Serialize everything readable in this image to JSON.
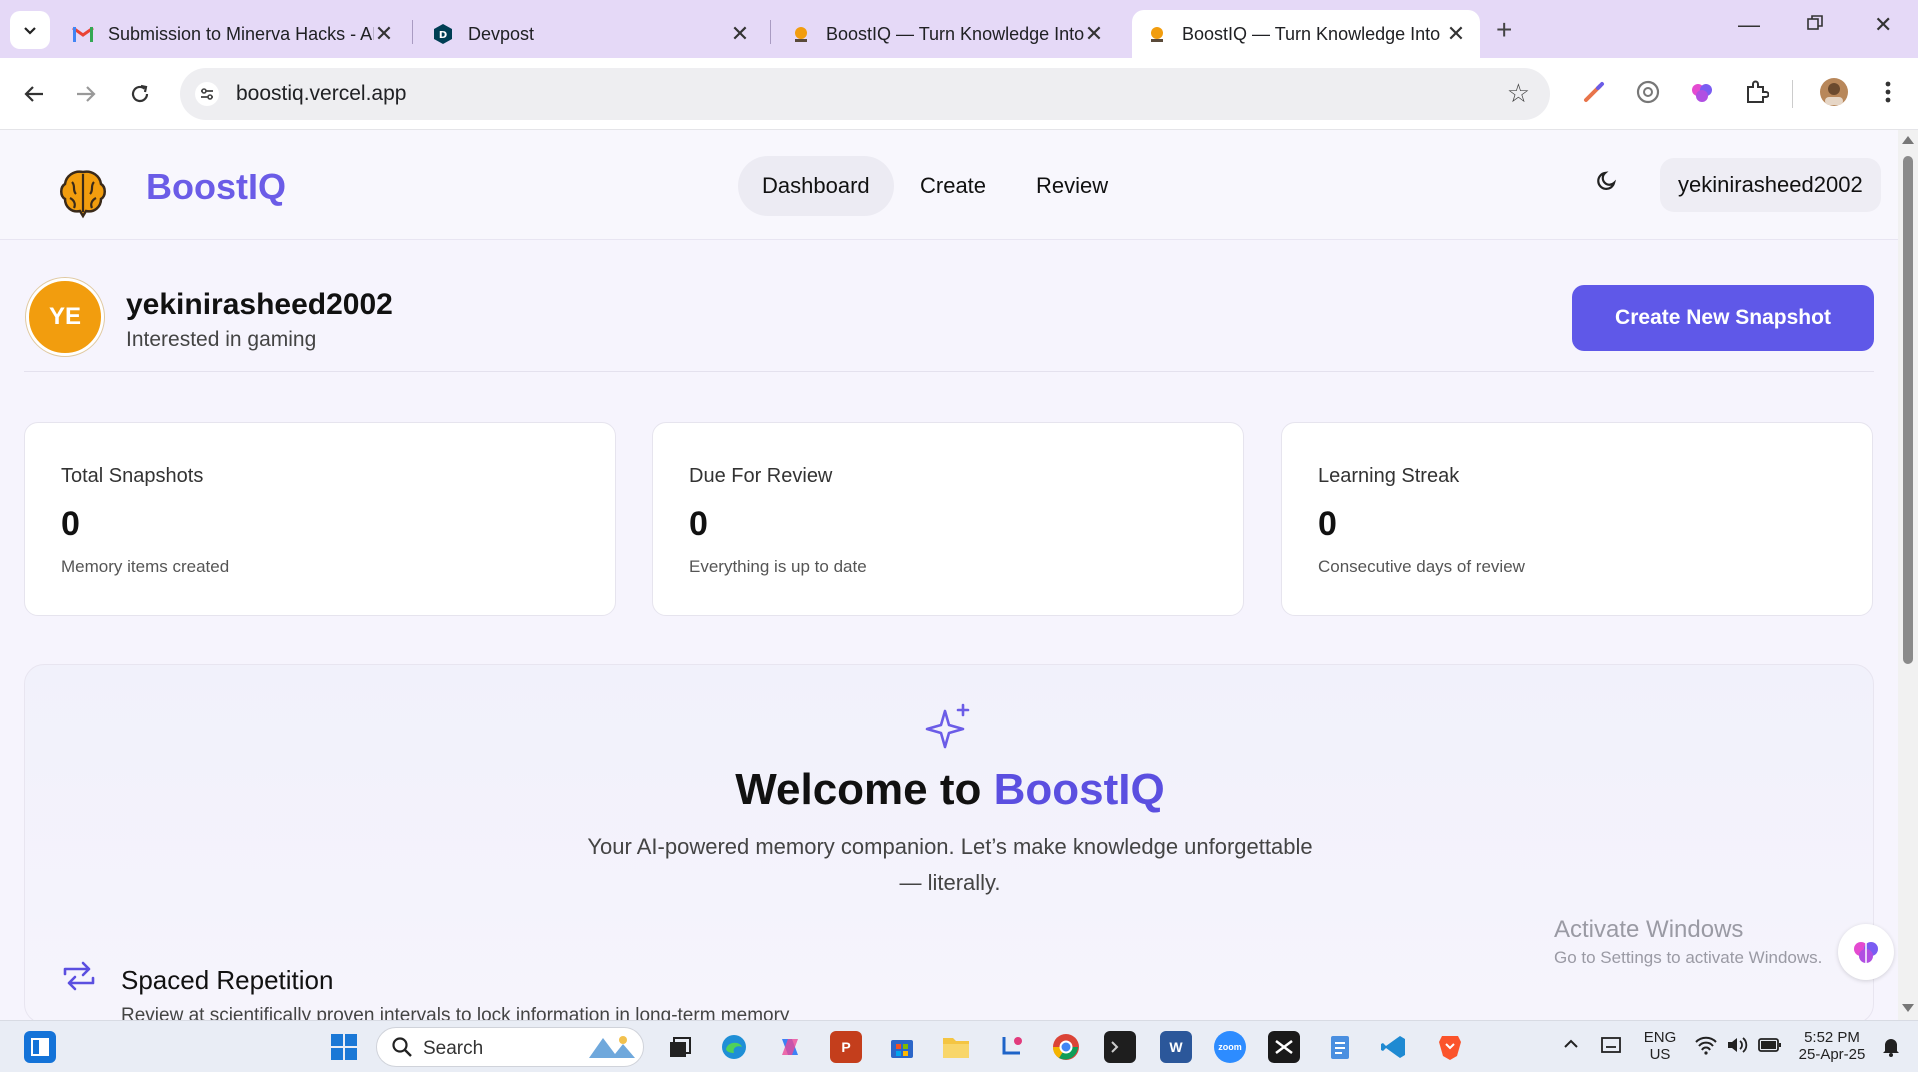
{
  "browser": {
    "tabs": [
      {
        "title": "Submission to Minerva Hacks - AI",
        "favicon": "gmail-icon",
        "active": false
      },
      {
        "title": "Devpost",
        "favicon": "devpost-icon",
        "active": false
      },
      {
        "title": "BoostIQ — Turn Knowledge Into L",
        "favicon": "boostiq-favicon",
        "active": false
      },
      {
        "title": "BoostIQ — Turn Knowledge Into L",
        "favicon": "boostiq-favicon",
        "active": true
      }
    ],
    "new_tab": "+",
    "url": "boostiq.vercel.app"
  },
  "app": {
    "brand": "BoostIQ",
    "nav": [
      {
        "label": "Dashboard",
        "active": true
      },
      {
        "label": "Create",
        "active": false
      },
      {
        "label": "Review",
        "active": false
      }
    ],
    "user_chip": "yekinirasheed2002"
  },
  "profile": {
    "initials": "YE",
    "name": "yekinirasheed2002",
    "bio": "Interested in gaming",
    "create_button": "Create New Snapshot"
  },
  "stats": [
    {
      "label": "Total Snapshots",
      "value": "0",
      "sub": "Memory items created"
    },
    {
      "label": "Due For Review",
      "value": "0",
      "sub": "Everything is up to date"
    },
    {
      "label": "Learning Streak",
      "value": "0",
      "sub": "Consecutive days of review"
    }
  ],
  "welcome": {
    "title_prefix": "Welcome to ",
    "title_accent": "BoostIQ",
    "description": "Your AI-powered memory companion. Let’s make knowledge unforgettable — literally.",
    "feature_title": "Spaced Repetition",
    "feature_desc": "Review at scientifically proven intervals to lock information in long-term memory"
  },
  "watermark": {
    "line1": "Activate Windows",
    "line2": "Go to Settings to activate Windows."
  },
  "taskbar": {
    "search_label": "Search",
    "lang": "ENG",
    "region": "US",
    "time": "5:52 PM",
    "date": "25-Apr-25"
  },
  "colors": {
    "brand": "#6b5ce7",
    "primary_button": "#5f58e8",
    "avatar": "#f29d0e",
    "tabstrip": "#e5d9f7"
  }
}
